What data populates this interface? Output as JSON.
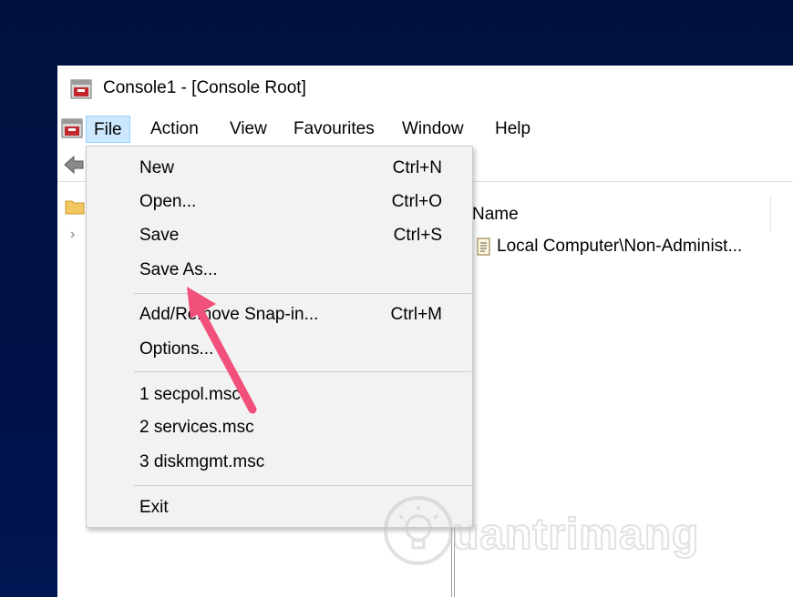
{
  "window": {
    "title": "Console1 - [Console Root]"
  },
  "menubar": {
    "items": [
      {
        "label": "File",
        "active": true
      },
      {
        "label": "Action"
      },
      {
        "label": "View"
      },
      {
        "label": "Favourites"
      },
      {
        "label": "Window"
      },
      {
        "label": "Help"
      }
    ]
  },
  "content": {
    "column_header": "Name",
    "rows": [
      {
        "label": "Local Computer\\Non-Administ..."
      }
    ]
  },
  "file_menu": {
    "items": [
      {
        "label": "New",
        "shortcut": "Ctrl+N"
      },
      {
        "label": "Open...",
        "shortcut": "Ctrl+O"
      },
      {
        "label": "Save",
        "shortcut": "Ctrl+S"
      },
      {
        "label": "Save As...",
        "shortcut": ""
      },
      {
        "label": "Add/Remove Snap-in...",
        "shortcut": "Ctrl+M"
      },
      {
        "label": "Options...",
        "shortcut": ""
      },
      {
        "label": "1 secpol.msc",
        "shortcut": ""
      },
      {
        "label": "2 services.msc",
        "shortcut": ""
      },
      {
        "label": "3 diskmgmt.msc",
        "shortcut": ""
      },
      {
        "label": "Exit",
        "shortcut": ""
      }
    ]
  },
  "annotation": {
    "arrow_color": "#f0507a"
  },
  "watermark": {
    "text": "uantrimang"
  },
  "colors": {
    "desktop": "#000e3f",
    "menu_active_bg": "#cce8ff",
    "dropdown_bg": "#f2f2f2"
  }
}
